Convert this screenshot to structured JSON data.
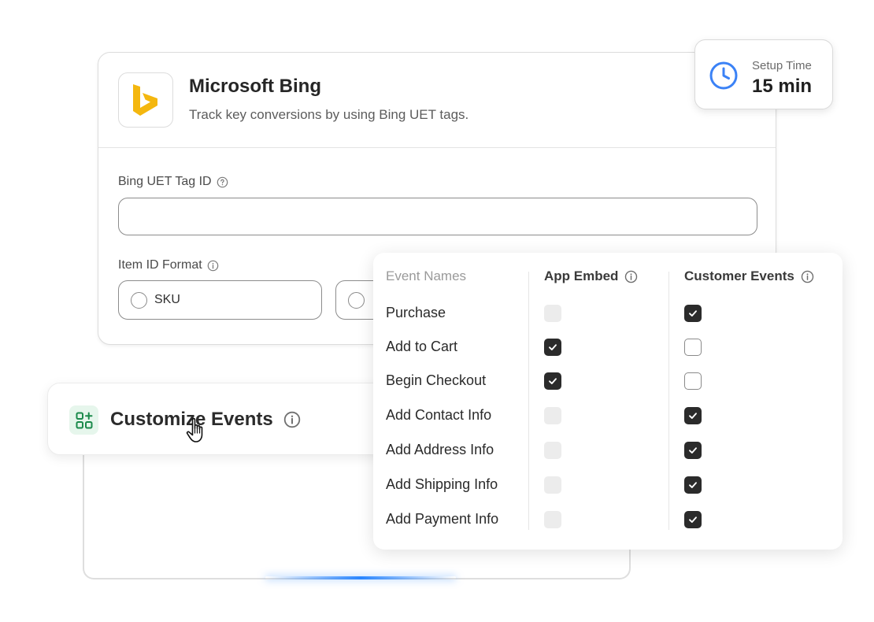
{
  "integration": {
    "title": "Microsoft Bing",
    "description": "Track key conversions by using Bing UET tags.",
    "tag_id_label": "Bing UET Tag ID",
    "tag_id_value": "",
    "item_id_format_label": "Item ID Format",
    "item_id_options": [
      {
        "label": "SKU",
        "selected": false
      },
      {
        "label": "",
        "selected": false
      }
    ],
    "brand_color": "#F4B70F"
  },
  "setup_time": {
    "label": "Setup Time",
    "value": "15 min",
    "icon": "clock-icon",
    "icon_color": "#3B82F6"
  },
  "customize_events": {
    "title": "Customize Events",
    "icon": "apps-add-icon",
    "icon_color": "#1B8A4B"
  },
  "events_table": {
    "headers": {
      "names": "Event Names",
      "app_embed": "App Embed",
      "customer_events": "Customer Events"
    },
    "rows": [
      {
        "name": "Purchase",
        "app_embed": "disabled",
        "customer_events": "checked"
      },
      {
        "name": "Add to Cart",
        "app_embed": "checked",
        "customer_events": "unchecked"
      },
      {
        "name": "Begin Checkout",
        "app_embed": "checked",
        "customer_events": "unchecked"
      },
      {
        "name": "Add Contact Info",
        "app_embed": "disabled",
        "customer_events": "checked"
      },
      {
        "name": "Add Address Info",
        "app_embed": "disabled",
        "customer_events": "checked"
      },
      {
        "name": "Add Shipping Info",
        "app_embed": "disabled",
        "customer_events": "checked"
      },
      {
        "name": "Add Payment Info",
        "app_embed": "disabled",
        "customer_events": "checked"
      }
    ]
  }
}
